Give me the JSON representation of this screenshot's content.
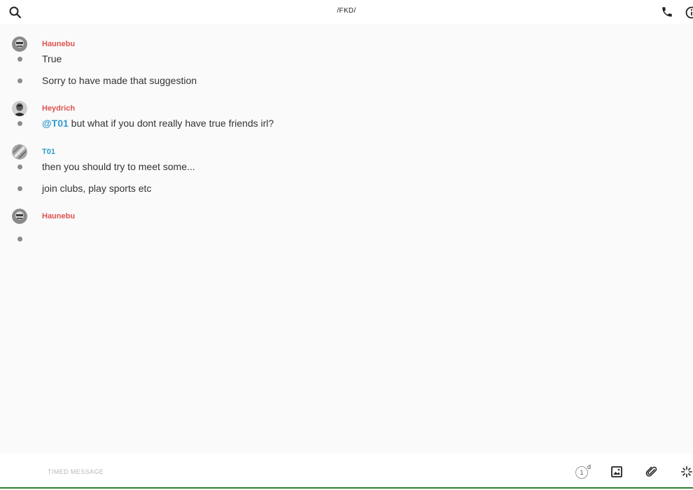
{
  "conversation": {
    "title": "/FKD/"
  },
  "colors": {
    "author_red": "#e0524f",
    "author_blue": "#2e9ccd",
    "mention_blue": "#2e9ccd"
  },
  "header": {
    "left_icon": "search-icon",
    "right_icons": [
      "phone-icon",
      "info-icon"
    ]
  },
  "messages": [
    {
      "author": "Haunebu",
      "author_color": "red",
      "lines": [
        {
          "text": "True"
        },
        {
          "text": "Sorry to have made that suggestion"
        }
      ]
    },
    {
      "author": "Heydrich",
      "author_color": "red",
      "lines": [
        {
          "mention": "@T01",
          "text": " but what if you dont really have true friends irl?"
        }
      ]
    },
    {
      "author": "T01",
      "author_color": "blue",
      "lines": [
        {
          "text": "then you should try to meet some..."
        },
        {
          "text": "join clubs, play sports etc"
        }
      ]
    },
    {
      "author": "Haunebu",
      "author_color": "red",
      "lines": [
        {
          "text": ""
        }
      ]
    }
  ],
  "footer": {
    "input_placeholder": "TIMED MESSAGE",
    "timer_value": "1",
    "timer_unit": "d",
    "icons": [
      "timer-icon",
      "image-icon",
      "paperclip-icon",
      "ping-icon"
    ]
  }
}
